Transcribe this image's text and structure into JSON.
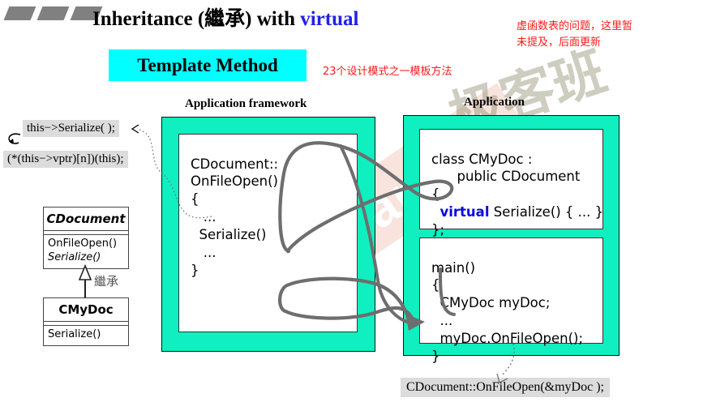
{
  "slide": {
    "title_plain": "Inheritance (繼承) with ",
    "title_keyword": "virtual",
    "template_method_label": "Template Method",
    "note_pattern": "23个设计模式之一模板方法",
    "note_vtable": "虚函数表的问题，这里暂未提及，后面更新",
    "watermark_text": "GeekBand",
    "watermark_cn": "极客班"
  },
  "colors": {
    "teal_panel": "#0FEFC0",
    "cyan_banner": "#00FFFF",
    "keyword_blue": "#0505E0",
    "title_blue": "#2121E8",
    "note_red": "#FF1A1A",
    "callout_grey": "#DCDCDC",
    "arrow_grey": "#6E6E6E",
    "bullet_grey": "#808080"
  },
  "callouts": {
    "this_serialize": "this−>Serialize( );",
    "vptr_dispatch": "(*(this−>vptr)[n])(this);",
    "loop_glyph": "↰",
    "bottom_call": "CDocument::OnFileOpen(&myDoc );"
  },
  "uml": {
    "inherit_label": "繼承",
    "base": {
      "name": "CDocument",
      "members": [
        "OnFileOpen()",
        "Serialize()"
      ]
    },
    "derived": {
      "name": "CMyDoc",
      "members": [
        "Serialize()"
      ]
    }
  },
  "panels": [
    {
      "caption": "Application framework",
      "code_lines": [
        "CDocument::",
        "OnFileOpen()",
        "{",
        "   ...",
        "  Serialize()",
        "   ...",
        "}"
      ]
    },
    {
      "caption": "Application",
      "class_code_pre": "class CMyDoc :\n      public CDocument\n{\n  ",
      "class_code_keyword": "virtual",
      "class_code_post": " Serialize() { ... }\n};",
      "main_code": "main()\n{\n  CMyDoc myDoc;\n  ...\n  myDoc.OnFileOpen();\n}"
    }
  ]
}
